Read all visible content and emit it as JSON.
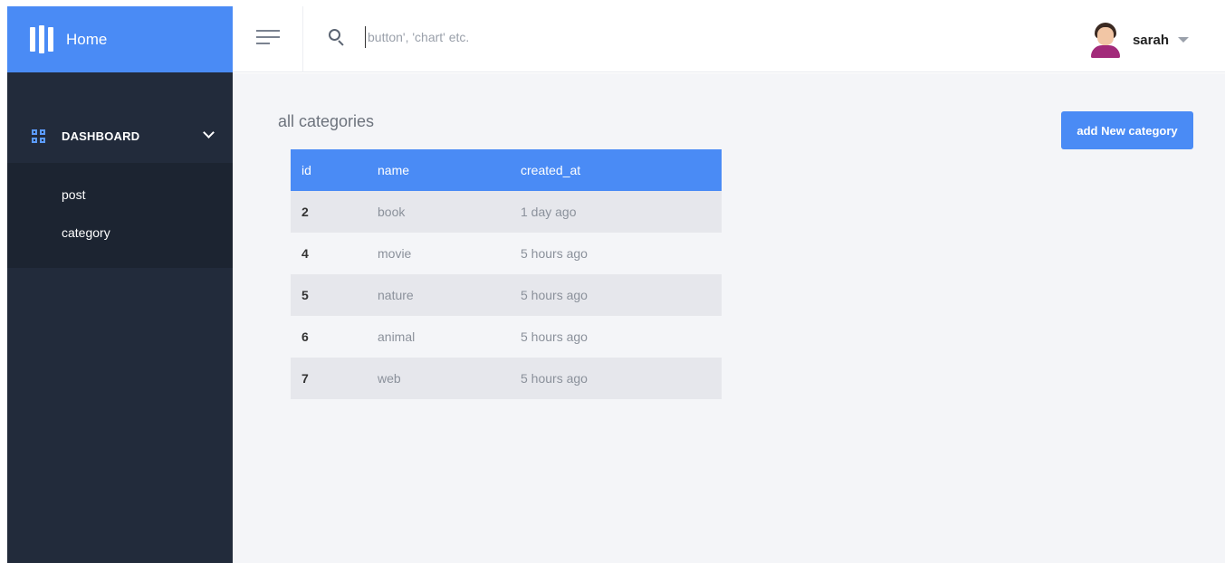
{
  "sidebar": {
    "brand_title": "Home",
    "nav": {
      "dashboard_label": "DASHBOARD",
      "items": [
        {
          "label": "post"
        },
        {
          "label": "category"
        }
      ]
    }
  },
  "topbar": {
    "search_placeholder": "button', 'chart' etc.",
    "user_name": "sarah"
  },
  "main": {
    "title": "all categories",
    "add_button_label": "add New category",
    "table": {
      "headers": [
        "id",
        "name",
        "created_at"
      ],
      "rows": [
        {
          "id": "2",
          "name": "book",
          "created_at": "1 day ago"
        },
        {
          "id": "4",
          "name": "movie",
          "created_at": "5 hours ago"
        },
        {
          "id": "5",
          "name": "nature",
          "created_at": "5 hours ago"
        },
        {
          "id": "6",
          "name": "animal",
          "created_at": "5 hours ago"
        },
        {
          "id": "7",
          "name": "web",
          "created_at": "5 hours ago"
        }
      ]
    }
  },
  "colors": {
    "accent": "#4a8bf5",
    "sidebar_bg": "#222b3b",
    "submenu_bg": "#1c2431",
    "main_bg": "#f4f5f8"
  }
}
